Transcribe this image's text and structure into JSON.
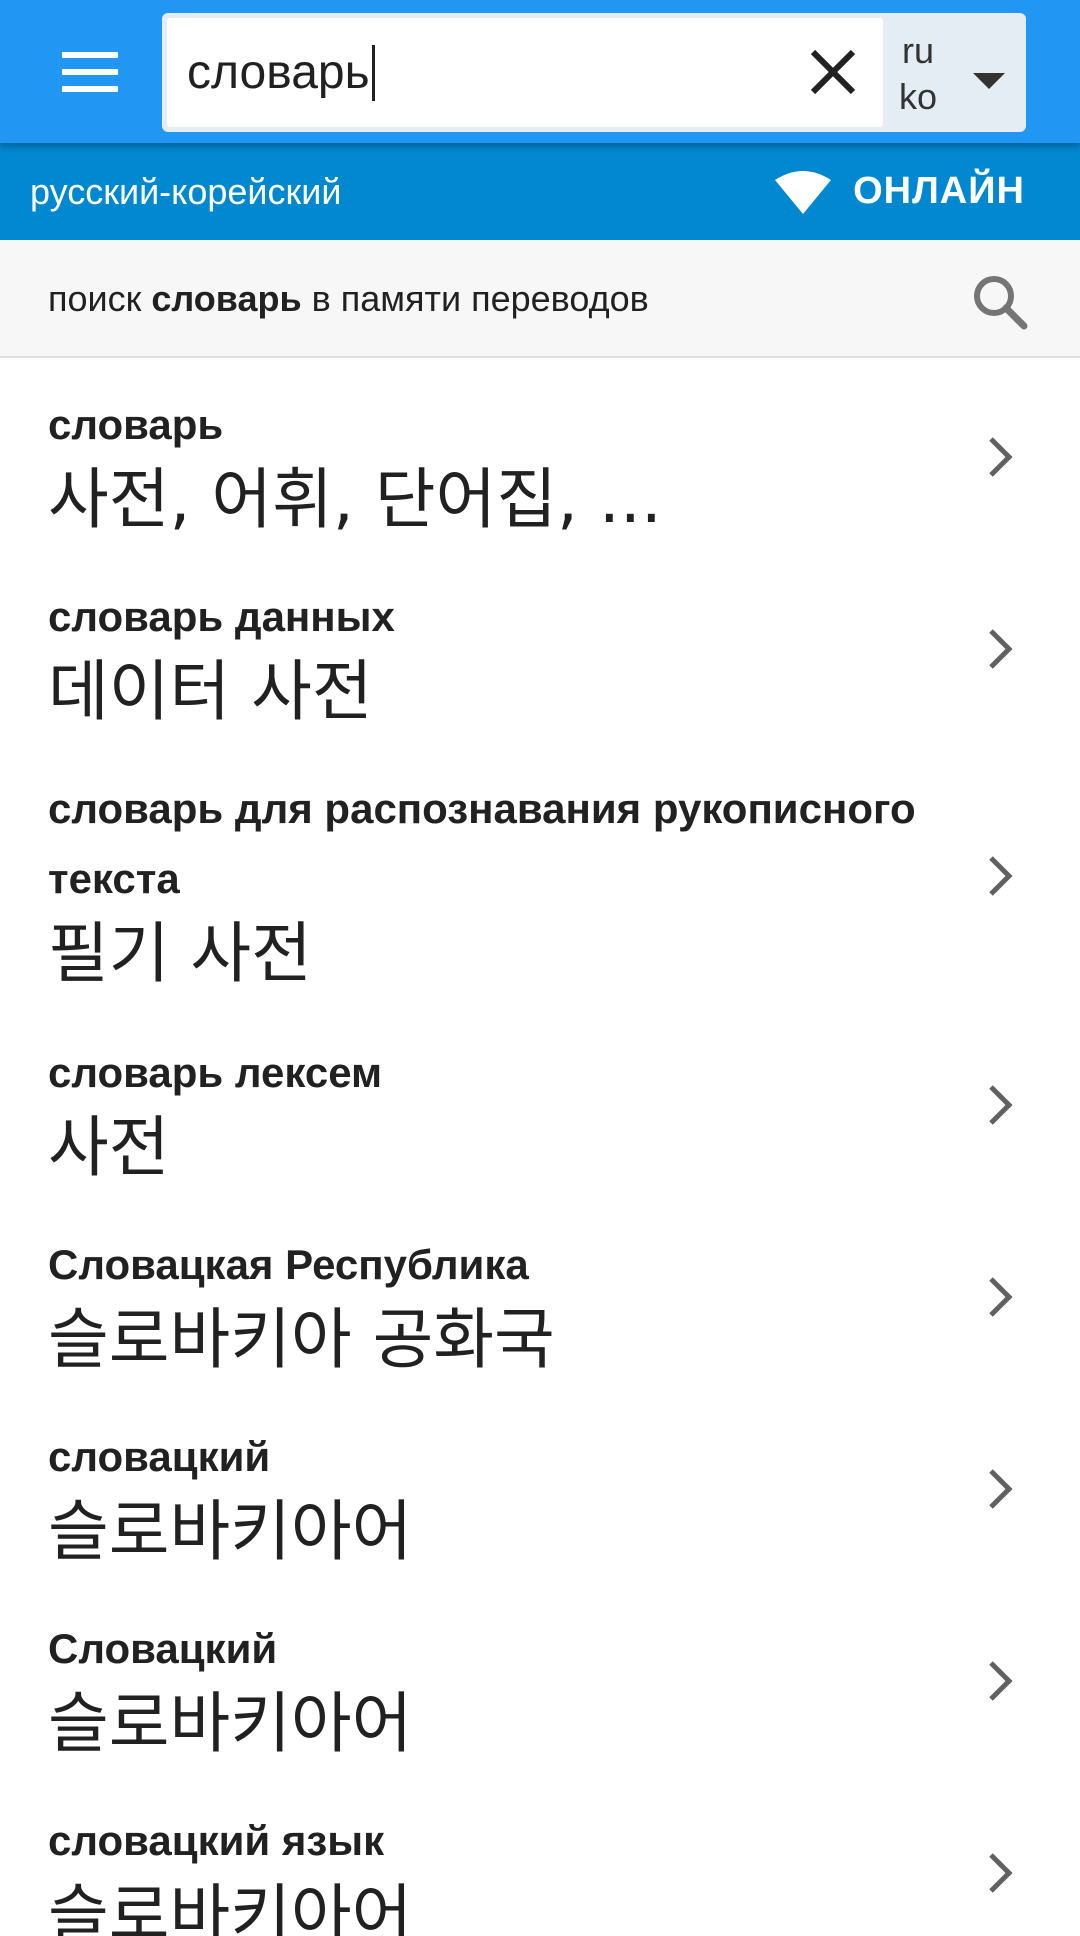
{
  "search": {
    "value": "словарь",
    "clear_icon": "close-icon"
  },
  "language": {
    "source_code": "ru",
    "target_code": "ko",
    "pair_label": "русский-корейский"
  },
  "status": {
    "label": "ОНЛАЙН",
    "icon": "wifi-icon"
  },
  "tm_search": {
    "prefix": "поиск",
    "term": "словарь",
    "suffix": "в памяти переводов"
  },
  "colors": {
    "primary": "#2196f3",
    "primary_dark": "#0288d1"
  },
  "results": [
    {
      "term": "словарь",
      "translation": "사전, 어휘, 단어집, ..."
    },
    {
      "term": "словарь данных",
      "translation": "데이터 사전"
    },
    {
      "term": "словарь для распознавания рукописного текста",
      "translation": "필기 사전"
    },
    {
      "term": "словарь лексем",
      "translation": "사전"
    },
    {
      "term": "Словацкая Республика",
      "translation": "슬로바키아 공화국"
    },
    {
      "term": "словацкий",
      "translation": "슬로바키아어"
    },
    {
      "term": "Словацкий",
      "translation": "슬로바키아어"
    },
    {
      "term": "словацкий язык",
      "translation": "슬로바키아어"
    }
  ]
}
